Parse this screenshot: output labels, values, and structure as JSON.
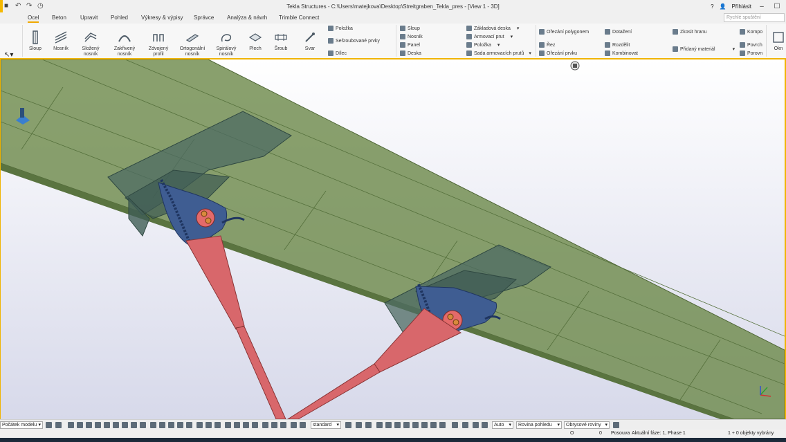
{
  "window": {
    "title": "Tekla Structures - C:\\Users\\matejkova\\Desktop\\Streitgraben_Tekla_pres - [View 1 - 3D]",
    "help": "?",
    "login": "Přihlásit"
  },
  "tabs": [
    "Ocel",
    "Beton",
    "Upravit",
    "Pohled",
    "Výkresy & výpisy",
    "Správce",
    "Analýza & návrh",
    "Trimble Connect"
  ],
  "search": {
    "placeholder": "Rychlé spuštění"
  },
  "ribbon": {
    "big_buttons": [
      {
        "label": "Sloup",
        "icon": "column-icon"
      },
      {
        "label": "Nosník",
        "icon": "beam-icon"
      },
      {
        "label": "Složený nosník",
        "icon": "polybeam-icon"
      },
      {
        "label": "Zakřivený nosník",
        "icon": "curved-beam-icon"
      },
      {
        "label": "Zdvojený profil",
        "icon": "twin-profile-icon"
      },
      {
        "label": "Ortogonální nosník",
        "icon": "orthogonal-beam-icon"
      },
      {
        "label": "Spirálový nosník",
        "icon": "spiral-beam-icon"
      },
      {
        "label": "Plech",
        "icon": "plate-icon"
      },
      {
        "label": "Šroub",
        "icon": "bolt-icon"
      },
      {
        "label": "Svar",
        "icon": "weld-icon"
      }
    ],
    "steel_small": [
      "Položka",
      "Sešroubované prvky",
      "Dílec"
    ],
    "concrete_col1": [
      "Sloup",
      "Nosník",
      "Panel",
      "Deska"
    ],
    "concrete_col2": [
      "Základová deska",
      "Armovací prut",
      "Položka",
      "Sada armovacích prutů"
    ],
    "edit_col1": [
      "Ořezání polygonem",
      "Řez",
      "Ořezání prvku"
    ],
    "edit_col2": [
      "Dotažení",
      "Rozdělit",
      "Kombinovat"
    ],
    "edit_col3": [
      "Zkosit hranu",
      "Přidaný materiál"
    ],
    "edit_col4": [
      "Kompo",
      "Povrch",
      "Porovn"
    ],
    "edit_col5": "Okn"
  },
  "bottombar": {
    "origin_select": "Počátek modelu",
    "standard_select": "standard",
    "auto_select": "Auto",
    "plane_select": "Rovina pohledu",
    "outline_select": "Obrysové roviny"
  },
  "statusbar": {
    "coord1": "O",
    "coord2": "0",
    "mode": "Posouva",
    "phase": "Aktuální fáze: 1, Phase 1",
    "selection": "1 + 0 objekty vybrány"
  },
  "colors": {
    "accent": "#f0b400",
    "slab": "#6e8a4a",
    "connection": "#3d5b8a",
    "diagonal": "#d9666a"
  }
}
